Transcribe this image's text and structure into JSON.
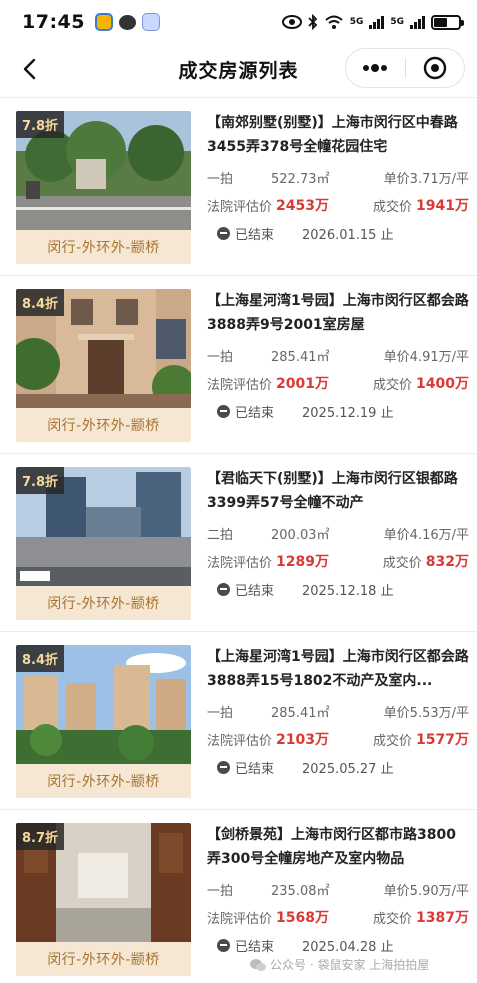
{
  "status_bar": {
    "time": "17:45",
    "net1": "5G",
    "net2": "5G",
    "battery_level": 0.55
  },
  "nav": {
    "title": "成交房源列表"
  },
  "listings": [
    {
      "discount": "7.8折",
      "area": "闵行-外环外-颛桥",
      "title": "【南郊别墅(别墅)】上海市闵行区中春路3455弄378号全幢花园住宅",
      "stage": "一拍",
      "size": "522.73㎡",
      "unit_price": "单价3.71万/平",
      "appraisal_label": "法院评估价",
      "appraisal": "2453万",
      "deal_label": "成交价",
      "deal": "1941万",
      "status": "已结束",
      "end_date": "2026.01.15 止"
    },
    {
      "discount": "8.4折",
      "area": "闵行-外环外-颛桥",
      "title": "【上海星河湾1号园】上海市闵行区都会路3888弄9号2001室房屋",
      "stage": "一拍",
      "size": "285.41㎡",
      "unit_price": "单价4.91万/平",
      "appraisal_label": "法院评估价",
      "appraisal": "2001万",
      "deal_label": "成交价",
      "deal": "1400万",
      "status": "已结束",
      "end_date": "2025.12.19 止"
    },
    {
      "discount": "7.8折",
      "area": "闵行-外环外-颛桥",
      "title": "【君临天下(别墅)】上海市闵行区银都路3399弄57号全幢不动产",
      "stage": "二拍",
      "size": "200.03㎡",
      "unit_price": "单价4.16万/平",
      "appraisal_label": "法院评估价",
      "appraisal": "1289万",
      "deal_label": "成交价",
      "deal": "832万",
      "status": "已结束",
      "end_date": "2025.12.18 止"
    },
    {
      "discount": "8.4折",
      "area": "闵行-外环外-颛桥",
      "title": "【上海星河湾1号园】上海市闵行区都会路3888弄15号1802不动产及室内...",
      "stage": "一拍",
      "size": "285.41㎡",
      "unit_price": "单价5.53万/平",
      "appraisal_label": "法院评估价",
      "appraisal": "2103万",
      "deal_label": "成交价",
      "deal": "1577万",
      "status": "已结束",
      "end_date": "2025.05.27 止"
    },
    {
      "discount": "8.7折",
      "area": "闵行-外环外-颛桥",
      "title": "【剑桥景苑】上海市闵行区都市路3800弄300号全幢房地产及室内物品",
      "stage": "一拍",
      "size": "235.08㎡",
      "unit_price": "单价5.90万/平",
      "appraisal_label": "法院评估价",
      "appraisal": "1568万",
      "deal_label": "成交价",
      "deal": "1387万",
      "status": "已结束",
      "end_date": "2025.04.28 止"
    }
  ],
  "watermark": "公众号 · 袋鼠安家 上海拍拍屋",
  "colors": {
    "accent_red": "#d93a35",
    "tag_bg": "#f5e7d3",
    "tag_text": "#a8742d"
  }
}
